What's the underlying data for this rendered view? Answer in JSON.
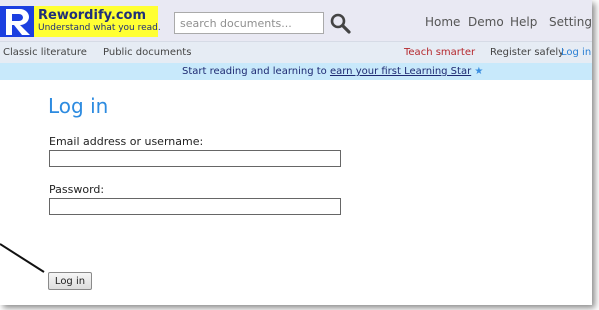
{
  "header": {
    "logo_title": "Rewordify.com",
    "logo_tagline": "Understand what you read.",
    "search": {
      "placeholder": "search documents...",
      "value": ""
    },
    "nav": {
      "home": "Home",
      "demo": "Demo",
      "help": "Help",
      "settings": "Settings"
    }
  },
  "subnav": {
    "classic": "Classic literature",
    "public": "Public documents",
    "teach": "Teach smarter",
    "register": "Register safely",
    "login": "Log in"
  },
  "banner": {
    "text": "Start reading and learning to ",
    "link": "earn your first Learning Star",
    "star": "★"
  },
  "form": {
    "title": "Log in",
    "email_label": "Email address or username:",
    "email_value": "",
    "password_label": "Password:",
    "password_value": "",
    "submit_label": "Log in"
  },
  "colors": {
    "logo_r": "#1c3fe0",
    "logo_yellow": "#ffff33",
    "title_blue": "#2d8be0",
    "subnav_red": "#b5282d",
    "subnav_link_blue": "#2a7fd4",
    "banner_bg": "#c8e9fb"
  },
  "icons": {
    "search": "search-icon",
    "logo": "logo-r-icon"
  }
}
